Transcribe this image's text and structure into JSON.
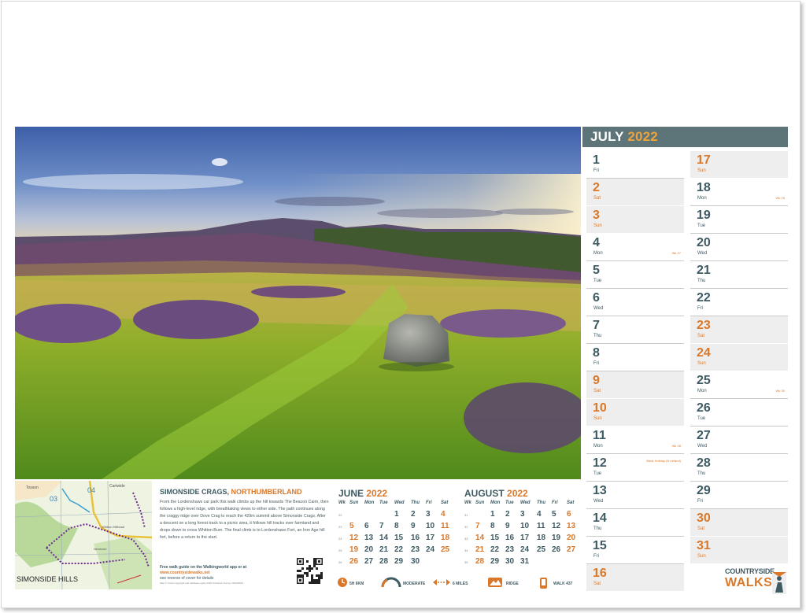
{
  "month": {
    "name": "JULY",
    "year": "2022"
  },
  "days_left": [
    {
      "num": "1",
      "name": "Fri",
      "weekend": false,
      "orange": false,
      "wk": "",
      "hol": ""
    },
    {
      "num": "2",
      "name": "Sat",
      "weekend": true,
      "orange": true,
      "wk": "",
      "hol": ""
    },
    {
      "num": "3",
      "name": "Sun",
      "weekend": true,
      "orange": true,
      "wk": "",
      "hol": ""
    },
    {
      "num": "4",
      "name": "Mon",
      "weekend": false,
      "orange": false,
      "wk": "Wk 27",
      "hol": ""
    },
    {
      "num": "5",
      "name": "Tue",
      "weekend": false,
      "orange": false,
      "wk": "",
      "hol": ""
    },
    {
      "num": "6",
      "name": "Wed",
      "weekend": false,
      "orange": false,
      "wk": "",
      "hol": ""
    },
    {
      "num": "7",
      "name": "Thu",
      "weekend": false,
      "orange": false,
      "wk": "",
      "hol": ""
    },
    {
      "num": "8",
      "name": "Fri",
      "weekend": false,
      "orange": false,
      "wk": "",
      "hol": ""
    },
    {
      "num": "9",
      "name": "Sat",
      "weekend": true,
      "orange": true,
      "wk": "",
      "hol": ""
    },
    {
      "num": "10",
      "name": "Sun",
      "weekend": true,
      "orange": true,
      "wk": "",
      "hol": ""
    },
    {
      "num": "11",
      "name": "Mon",
      "weekend": false,
      "orange": false,
      "wk": "Wk 28",
      "hol": ""
    },
    {
      "num": "12",
      "name": "Tue",
      "weekend": false,
      "orange": false,
      "wk": "",
      "hol": "Bank Holiday (N Ireland)"
    },
    {
      "num": "13",
      "name": "Wed",
      "weekend": false,
      "orange": false,
      "wk": "",
      "hol": ""
    },
    {
      "num": "14",
      "name": "Thu",
      "weekend": false,
      "orange": false,
      "wk": "",
      "hol": ""
    },
    {
      "num": "15",
      "name": "Fri",
      "weekend": false,
      "orange": false,
      "wk": "",
      "hol": ""
    },
    {
      "num": "16",
      "name": "Sat",
      "weekend": true,
      "orange": true,
      "wk": "",
      "hol": ""
    }
  ],
  "days_right": [
    {
      "num": "17",
      "name": "Sun",
      "weekend": true,
      "orange": true,
      "wk": "",
      "hol": ""
    },
    {
      "num": "18",
      "name": "Mon",
      "weekend": false,
      "orange": false,
      "wk": "Wk 29",
      "hol": ""
    },
    {
      "num": "19",
      "name": "Tue",
      "weekend": false,
      "orange": false,
      "wk": "",
      "hol": ""
    },
    {
      "num": "20",
      "name": "Wed",
      "weekend": false,
      "orange": false,
      "wk": "",
      "hol": ""
    },
    {
      "num": "21",
      "name": "Thu",
      "weekend": false,
      "orange": false,
      "wk": "",
      "hol": ""
    },
    {
      "num": "22",
      "name": "Fri",
      "weekend": false,
      "orange": false,
      "wk": "",
      "hol": ""
    },
    {
      "num": "23",
      "name": "Sat",
      "weekend": true,
      "orange": true,
      "wk": "",
      "hol": ""
    },
    {
      "num": "24",
      "name": "Sun",
      "weekend": true,
      "orange": true,
      "wk": "",
      "hol": ""
    },
    {
      "num": "25",
      "name": "Mon",
      "weekend": false,
      "orange": false,
      "wk": "Wk 30",
      "hol": ""
    },
    {
      "num": "26",
      "name": "Tue",
      "weekend": false,
      "orange": false,
      "wk": "",
      "hol": ""
    },
    {
      "num": "27",
      "name": "Wed",
      "weekend": false,
      "orange": false,
      "wk": "",
      "hol": ""
    },
    {
      "num": "28",
      "name": "Thu",
      "weekend": false,
      "orange": false,
      "wk": "",
      "hol": ""
    },
    {
      "num": "29",
      "name": "Fri",
      "weekend": false,
      "orange": false,
      "wk": "",
      "hol": ""
    },
    {
      "num": "30",
      "name": "Sat",
      "weekend": true,
      "orange": true,
      "wk": "",
      "hol": ""
    },
    {
      "num": "31",
      "name": "Sun",
      "weekend": true,
      "orange": true,
      "wk": "",
      "hol": ""
    }
  ],
  "walk": {
    "title": "SIMONSIDE CRAGS, ",
    "region": "NORTHUMBERLAND",
    "description": "From the Lordenshaws car park this walk climbs up the hill towards The Beacon Cairn, then follows a high-level ridge, with breathtaking views to either side. The path continues along the craggy ridge over Dove Crag to reach the 429m summit above Simonside Crags. After a descent on a long forest track to a picnic area, it follows hill tracks over farmland and drops down to cross Whitton Burn. The final climb is to Lordenshaws Fort, an Iron Age hill fort, before a return to the start.",
    "guide_prefix": "Free walk guide on the Walkingworld app or at ",
    "guide_url": "www.countrysidewalks.net",
    "guide_suffix": "see reverse of cover for details",
    "copyright": "Map © Crown copyright and database rights 2020 Ordnance Survey 100004821"
  },
  "map": {
    "label": "SIMONSIDE HILLS",
    "grid_a": "03",
    "grid_b": "04",
    "place_a": "Tosson",
    "place_b": "Cartwide",
    "place_c": "Whitton Hillhead",
    "place_d": "Newtown"
  },
  "june": {
    "name": "JUNE",
    "year": "2022",
    "headers": [
      "Wk",
      "Sun",
      "Mon",
      "Tue",
      "Wed",
      "Thu",
      "Fri",
      "Sat"
    ],
    "rows": [
      [
        "22",
        "",
        "",
        "",
        "1",
        "2",
        "3",
        "4"
      ],
      [
        "23",
        "5",
        "6",
        "7",
        "8",
        "9",
        "10",
        "11"
      ],
      [
        "24",
        "12",
        "13",
        "14",
        "15",
        "16",
        "17",
        "18"
      ],
      [
        "25",
        "19",
        "20",
        "21",
        "22",
        "23",
        "24",
        "25"
      ],
      [
        "26",
        "26",
        "27",
        "28",
        "29",
        "30",
        "",
        ""
      ]
    ]
  },
  "august": {
    "name": "AUGUST",
    "year": "2022",
    "headers": [
      "Wk",
      "Sun",
      "Mon",
      "Tue",
      "Wed",
      "Thu",
      "Fri",
      "Sat"
    ],
    "rows": [
      [
        "31",
        "",
        "1",
        "2",
        "3",
        "4",
        "5",
        "6"
      ],
      [
        "32",
        "7",
        "8",
        "9",
        "10",
        "11",
        "12",
        "13"
      ],
      [
        "33",
        "14",
        "15",
        "16",
        "17",
        "18",
        "19",
        "20"
      ],
      [
        "34",
        "21",
        "22",
        "23",
        "24",
        "25",
        "26",
        "27"
      ],
      [
        "35",
        "28",
        "29",
        "30",
        "31",
        "",
        "",
        ""
      ]
    ]
  },
  "stats": {
    "distance": "5H 6KM",
    "difficulty": "MODERATE",
    "length": "6 MILES",
    "terrain": "RIDGE",
    "walk_id": "WALK 437"
  },
  "logo": {
    "top": "COUNTRYSIDE",
    "bottom": "WALKS"
  },
  "colors": {
    "accent": "#d9782b",
    "primary": "#3e5a62",
    "header_bg": "#5d7479",
    "year": "#f0a33b"
  }
}
